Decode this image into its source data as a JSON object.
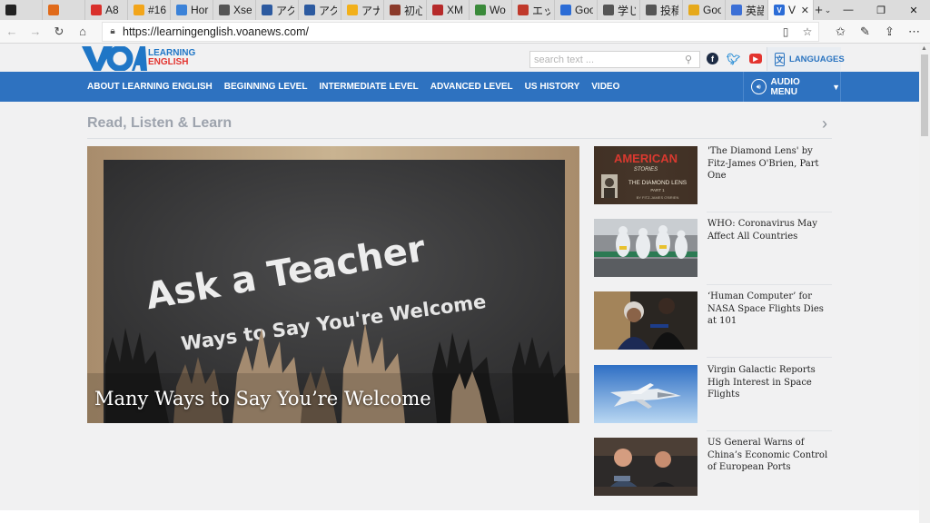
{
  "browser": {
    "tabs": [
      {
        "label": "",
        "color": "#222222"
      },
      {
        "label": "",
        "color": "#e06a1a"
      },
      {
        "label": "A8",
        "color": "#d9302b"
      },
      {
        "label": "#16",
        "color": "#f2a51a"
      },
      {
        "label": "Hor",
        "color": "#3b82d8"
      },
      {
        "label": "Xse",
        "color": "#555555"
      },
      {
        "label": "アク",
        "color": "#2c5aa0"
      },
      {
        "label": "アク",
        "color": "#2c5aa0"
      },
      {
        "label": "アナ",
        "color": "#f2b01a"
      },
      {
        "label": "初心",
        "color": "#8b3a2a"
      },
      {
        "label": "XM",
        "color": "#b62a2a"
      },
      {
        "label": "Wo",
        "color": "#3a8a3a"
      },
      {
        "label": "エッ",
        "color": "#c0392b"
      },
      {
        "label": "Goo",
        "color": "#2b6cd6"
      },
      {
        "label": "学じ",
        "color": "#555555"
      },
      {
        "label": "投稿",
        "color": "#555555"
      },
      {
        "label": "Goo",
        "color": "#e6a91a"
      },
      {
        "label": "英語",
        "color": "#3b6fd6"
      }
    ],
    "active_tab": {
      "label": "V",
      "color": "#2b6cd6"
    },
    "url": "https://learningenglish.voanews.com/"
  },
  "header": {
    "logo_text": "VOA",
    "logo_line1": "LEARNING",
    "logo_line2": "ENGLISH",
    "search_placeholder": "search text ...",
    "languages_label": "LANGUAGES",
    "nav": [
      "ABOUT LEARNING ENGLISH",
      "BEGINNING LEVEL",
      "INTERMEDIATE LEVEL",
      "ADVANCED LEVEL",
      "US HISTORY",
      "VIDEO"
    ],
    "audio_menu": "AUDIO MENU"
  },
  "main": {
    "section_title": "Read, Listen & Learn",
    "hero": {
      "board_line1": "Ask a Teacher",
      "board_line2": "Ways to Say You're Welcome",
      "caption": "Many Ways to Say You’re Welcome"
    },
    "stories": [
      {
        "title": "'The Diamond Lens' by Fitz-James O'Brien, Part One",
        "thumb_title": "AMERICAN",
        "thumb_sub": "STORIES",
        "thumb_line": "THE DIAMOND LENS",
        "thumb_part": "PART 1",
        "thumb_by": "BY FITZ-JAMES O'BRIEN"
      },
      {
        "title": "WHO: Coronavirus May Affect All Countries"
      },
      {
        "title": "‘Human Computer’ for NASA Space Flights Dies at 101"
      },
      {
        "title": "Virgin Galactic Reports High Interest in Space Flights"
      },
      {
        "title": "US General Warns of China’s Economic Control of European Ports"
      }
    ]
  },
  "colors": {
    "brand_blue": "#2e72c0",
    "brand_red": "#e3342f"
  }
}
